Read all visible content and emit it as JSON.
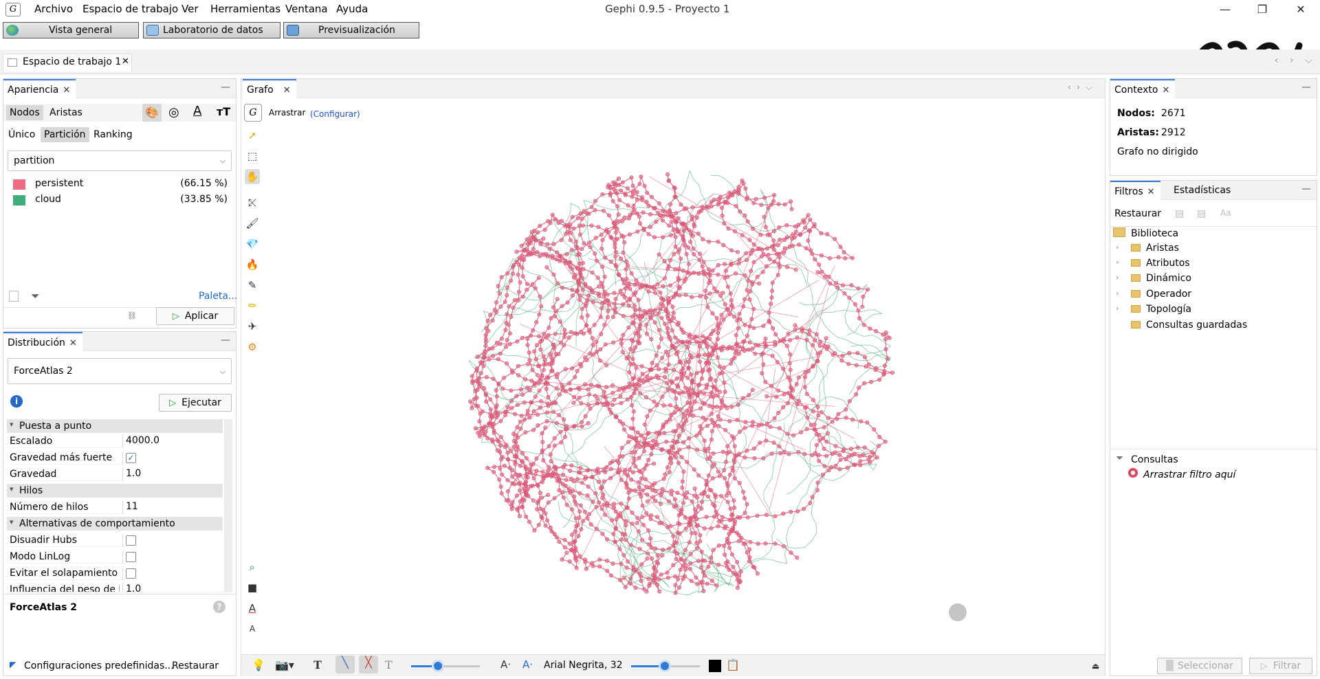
{
  "menu": {
    "items": [
      "Archivo",
      "Espacio de trabajo",
      "Ver",
      "Herramientas",
      "Ventana",
      "Ayuda"
    ],
    "window_title": "Gephi 0.9.5 - Proyecto 1",
    "controls": {
      "minimize": "—",
      "restore": "❐",
      "close": "✕"
    }
  },
  "workspace_buttons": {
    "overview": "Vista general",
    "data_lab": "Laboratorio de datos",
    "preview": "Previsualización"
  },
  "workspace_tab": {
    "label": "Espacio de trabajo 1",
    "close": "✕",
    "nav": "‹ › ⌵"
  },
  "appearance": {
    "title": "Apariencia",
    "close": "✕",
    "element_tabs": [
      "Nodos",
      "Aristas"
    ],
    "mode_tabs": [
      "Único",
      "Partición",
      "Ranking"
    ],
    "attribute": "partition",
    "partitions": [
      {
        "name": "persistent",
        "percent": "(66.15 %)",
        "color": "#f06c86"
      },
      {
        "name": "cloud",
        "percent": "(33.85 %)",
        "color": "#3dae79"
      }
    ],
    "palette_link": "Paleta...",
    "apply_label": "Aplicar"
  },
  "layout": {
    "title": "Distribución",
    "close": "✕",
    "algorithm": "ForceAtlas 2",
    "run_label": "Ejecutar",
    "cat_tuning": "Puesta a punto",
    "rows_tuning": [
      {
        "key": "Escalado",
        "value": "4000.0"
      },
      {
        "key": "Gravedad más fuerte",
        "value": "✓"
      },
      {
        "key": "Gravedad",
        "value": "1.0"
      }
    ],
    "cat_threads": "Hilos",
    "rows_threads": [
      {
        "key": "Número de hilos",
        "value": "11"
      }
    ],
    "cat_behavior": "Alternativas de comportamiento",
    "rows_behavior": [
      {
        "key": "Disuadir Hubs",
        "value": ""
      },
      {
        "key": "Modo LinLog",
        "value": ""
      },
      {
        "key": "Evitar el solapamiento",
        "value": ""
      },
      {
        "key": "Influencia del peso de la arista",
        "value": "1.0"
      }
    ],
    "footer_title": "ForceAtlas 2",
    "presets": "Configuraciones predefinidas...",
    "restore": "Restaurar"
  },
  "graph": {
    "tab": "Grafo",
    "close": "✕",
    "tool_name": "Arrastrar",
    "configure": "(Configurar)",
    "bottom_font": "Arial Negrita, 32",
    "node_color_primary": "#d95a79",
    "node_color_secondary": "#4fb27c"
  },
  "context": {
    "title": "Contexto",
    "close": "✕",
    "nodes_label": "Nodos:",
    "nodes_value": "2671",
    "edges_label": "Aristas:",
    "edges_value": "2912",
    "graph_type": "Grafo no dirigido"
  },
  "filters": {
    "tab_filters": "Filtros",
    "close": "✕",
    "tab_stats": "Estadísticas",
    "restore": "Restaurar",
    "library": "Biblioteca",
    "tree": [
      "Aristas",
      "Atributos",
      "Dinámico",
      "Operador",
      "Topología"
    ],
    "saved_queries": "Consultas guardadas",
    "queries_label": "Consultas",
    "drop_hint": "Arrastrar filtro aquí",
    "select_label": "Seleccionar",
    "filter_label": "Filtrar"
  }
}
